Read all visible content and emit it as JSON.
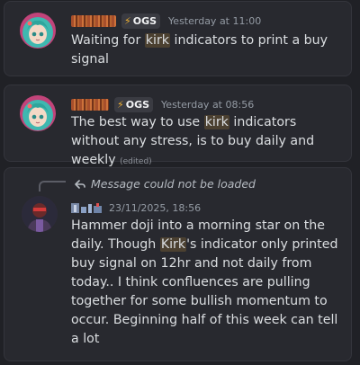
{
  "messages": [
    {
      "tag": "OGS",
      "timestamp": "Yesterday at 11:00",
      "text_before": "Waiting for ",
      "highlight": "kirk",
      "text_after": " indicators to print a buy signal"
    },
    {
      "tag": "OGS",
      "timestamp": "Yesterday at 08:56",
      "text_before": "The best way to use ",
      "highlight": "kirk",
      "text_after": " indicators without any stress, is to buy daily and weekly ",
      "edited": "(edited)"
    },
    {
      "reply": "Message could not be loaded",
      "timestamp": "23/11/2025, 18:56",
      "text_before": "Hammer doji into a morning star on the daily. Though ",
      "highlight": "Kirk",
      "text_after": "'s indicator only printed buy signal on 12hr and not daily from today.. I think confluences are pulling together for some bullish momentum to occur. Beginning half of this week can tell a lot"
    }
  ],
  "icons": {
    "tag_icon": "lightning-bolt-icon",
    "reply_icon": "reply-arrow-icon"
  },
  "colors": {
    "background": "#202126",
    "card": "#28292f",
    "text": "#dbdee1",
    "muted": "#949ba4",
    "highlight": "#4b4030",
    "bolt": "#f0b232"
  }
}
